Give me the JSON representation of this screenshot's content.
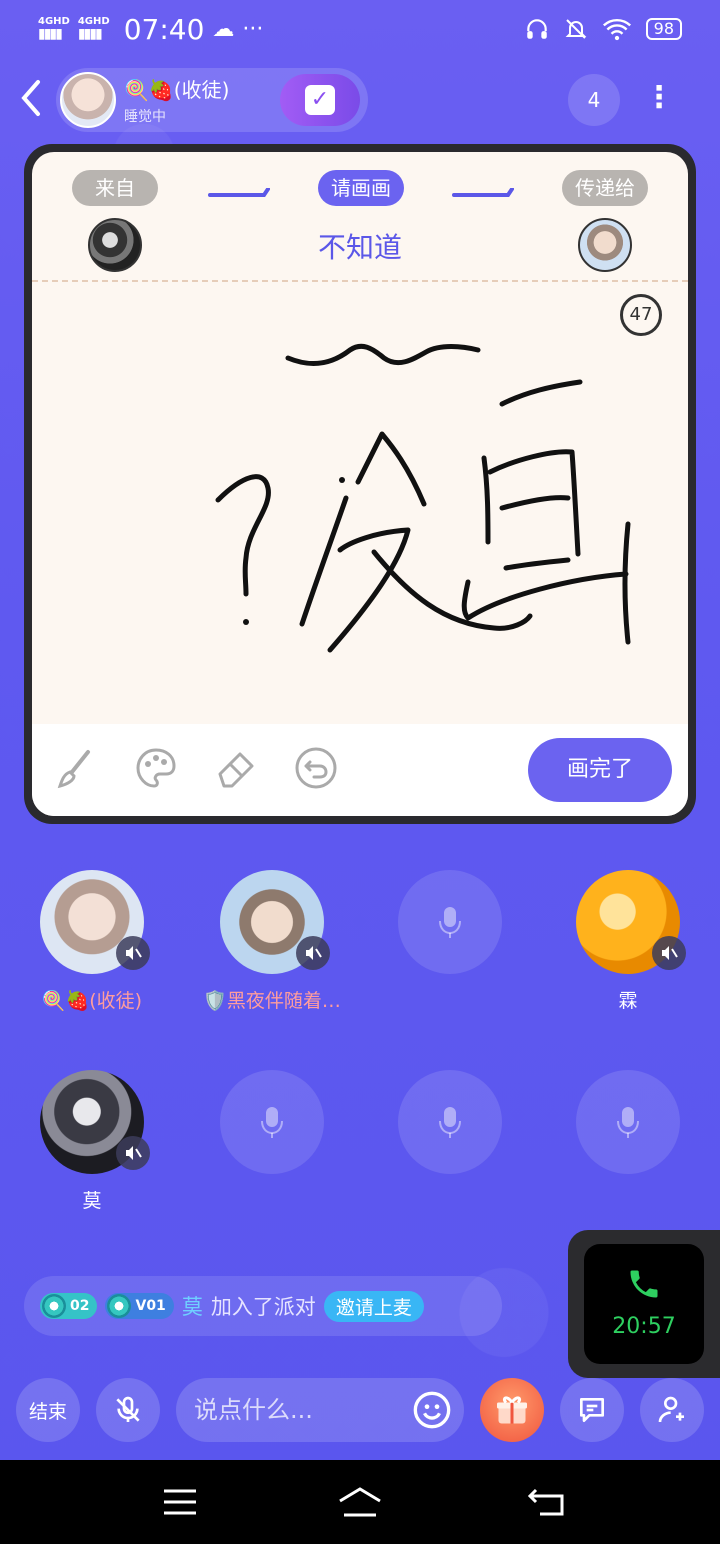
{
  "status_bar": {
    "network1": "4GHD",
    "network2": "4GHD",
    "time": "07:40",
    "battery": "98"
  },
  "header": {
    "room_name": "🍭🍓(收徒)",
    "room_status": "睡觉中",
    "online_count": "4"
  },
  "draw_card": {
    "from_label": "来自",
    "draw_label": "请画画",
    "to_label": "传递给",
    "prompt_word": "不知道",
    "timer": "47",
    "done_button": "画完了"
  },
  "seats": [
    {
      "name": "🍭🍓(收徒)",
      "occupied": true,
      "muted": true
    },
    {
      "name": "🛡️黑夜伴随着…",
      "occupied": true,
      "muted": true
    },
    {
      "name": "",
      "occupied": false
    },
    {
      "name": "霖",
      "occupied": true,
      "muted": true
    },
    {
      "name": "莫",
      "occupied": true,
      "muted": true
    },
    {
      "name": "",
      "occupied": false
    },
    {
      "name": "",
      "occupied": false
    },
    {
      "name": "",
      "occupied": false
    }
  ],
  "notice": {
    "level_badge": "02",
    "vip_badge": "V01",
    "user": "莫",
    "text": "加入了派对",
    "invite": "邀请上麦"
  },
  "call": {
    "duration": "20:57"
  },
  "bottom_bar": {
    "end_label": "结束",
    "input_placeholder": "说点什么..."
  },
  "colors": {
    "accent": "#6b63f0",
    "call_green": "#2ecf60",
    "invite_blue": "#39b6f5"
  }
}
